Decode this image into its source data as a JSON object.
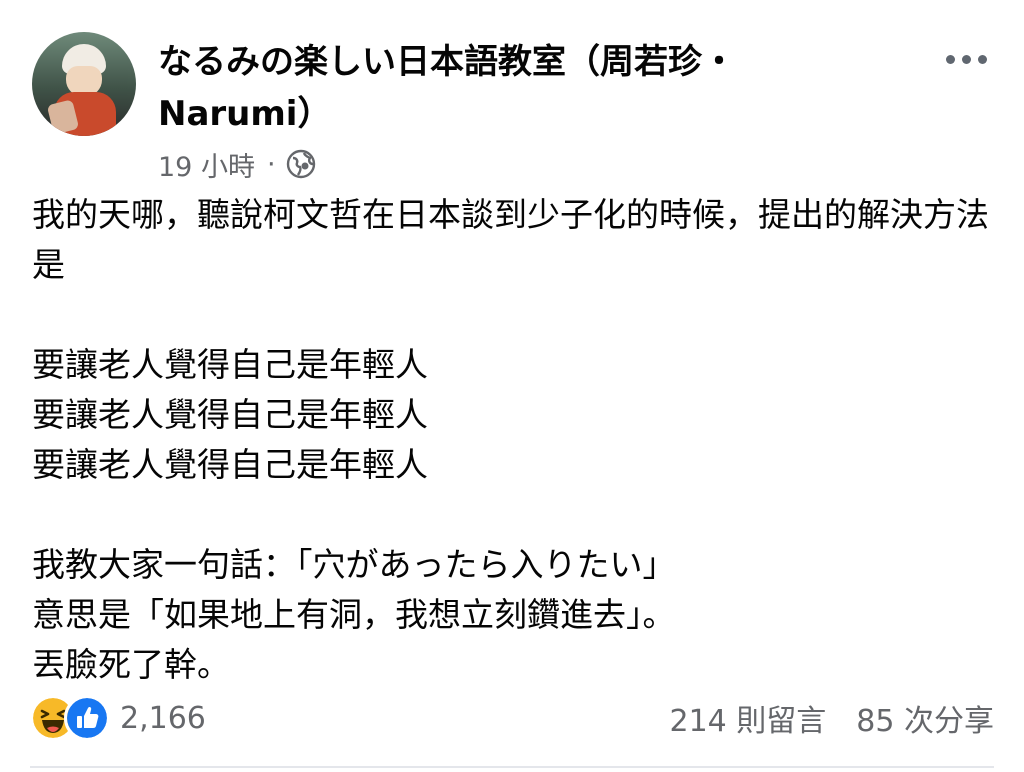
{
  "post": {
    "page_name": "なるみの楽しい日本語教室（周若珍・Narumi）",
    "time": "19 小時",
    "separator": "·",
    "audience_icon": "globe-icon",
    "more_icon": "more-horizontal-icon",
    "body": {
      "line1": "我的天哪，聽說柯文哲在日本談到少子化的時候，提出的解決方法是",
      "repeat1": "要讓老人覺得自己是年輕人",
      "repeat2": "要讓老人覺得自己是年輕人",
      "repeat3": "要讓老人覺得自己是年輕人",
      "line2": "我教大家一句話：「穴があったら入りたい」",
      "line3": "意思是「如果地上有洞，我想立刻鑽進去」。",
      "line4": "丟臉死了幹。"
    }
  },
  "footer": {
    "reaction_icons": [
      "haha-icon",
      "like-icon"
    ],
    "reaction_count": "2,166",
    "comments": "214 則留言",
    "shares": "85 次分享"
  },
  "colors": {
    "text": "#050505",
    "secondary": "#65676b",
    "like_blue": "#1877f2",
    "haha_yellow": "#f7b928"
  }
}
